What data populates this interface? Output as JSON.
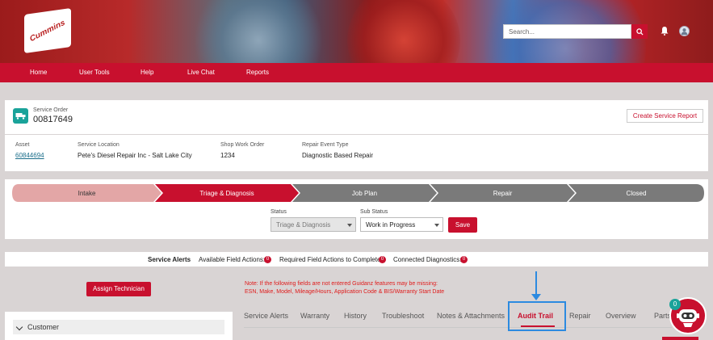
{
  "brand": {
    "logo_text": "Cummins",
    "primary_color": "#c8102e",
    "accent_teal": "#1aa39a",
    "highlight_blue": "#2c8ae0"
  },
  "header": {
    "search_placeholder": "Search...",
    "icons": [
      "search-icon",
      "bell-icon",
      "user-avatar-icon"
    ]
  },
  "nav": {
    "items": [
      "Home",
      "User Tools",
      "Help",
      "Live Chat",
      "Reports"
    ]
  },
  "service_order": {
    "label": "Service Order",
    "number": "00817649",
    "create_report_label": "Create Service Report",
    "details": [
      {
        "label": "Asset",
        "value": "60844694"
      },
      {
        "label": "Service Location",
        "value": "Pete's Diesel Repair Inc - Salt Lake City"
      },
      {
        "label": "Shop Work Order",
        "value": "1234"
      },
      {
        "label": "Repair Event Type",
        "value": "Diagnostic Based Repair"
      }
    ]
  },
  "stepper": {
    "steps": [
      "Intake",
      "Triage & Diagnosis",
      "Job Plan",
      "Repair",
      "Closed"
    ],
    "current": "Triage & Diagnosis"
  },
  "status_form": {
    "status_label": "Status",
    "status_value": "Triage & Diagnosis",
    "sub_status_label": "Sub Status",
    "sub_status_value": "Work in Progress",
    "save_label": "Save"
  },
  "alerts": {
    "title": "Service Alerts",
    "available_label": "Available Field Actions:",
    "available_count": "0",
    "required_label": "Required Field Actions to Complete:",
    "required_count": "0",
    "connected_label": "Connected Diagnostics:",
    "connected_count": "0"
  },
  "assign_label": "Assign Technician",
  "note": {
    "line1": "Note: If the following fields are not entered Guidanz features may be missing:",
    "line2": "ESN, Make, Model, Mileage/Hours, Application Code  & BIS/Warranty Start Date"
  },
  "customer_label": "Customer",
  "tabs": [
    "Service Alerts",
    "Warranty",
    "History",
    "Troubleshoot",
    "Notes & Attachments",
    "Audit Trail",
    "Repair",
    "Overview",
    "Parts"
  ],
  "active_tab": "Audit Trail",
  "bot": {
    "count": "0"
  }
}
